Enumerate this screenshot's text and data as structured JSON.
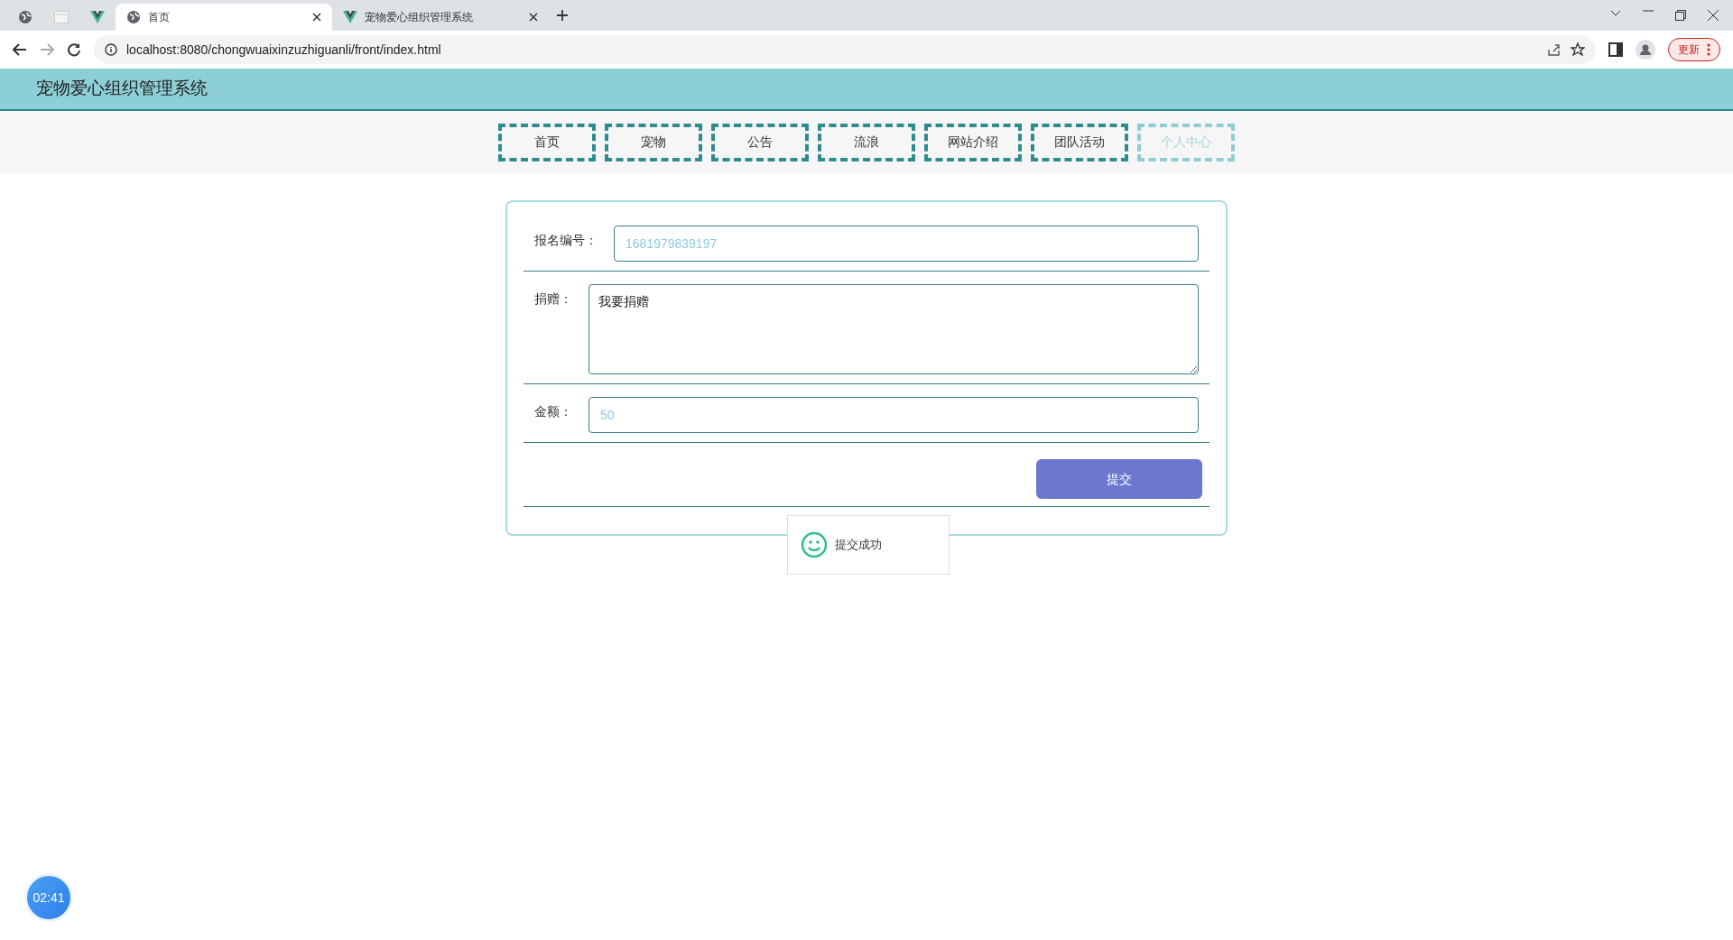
{
  "browser": {
    "tabs": [
      {
        "kind": "pinned",
        "selected": false
      },
      {
        "kind": "pinned",
        "selected": false
      },
      {
        "kind": "pinned",
        "selected": false
      },
      {
        "kind": "normal",
        "title": "首页",
        "selected": true
      },
      {
        "kind": "normal",
        "title": "宠物爱心组织管理系统",
        "selected": false
      }
    ],
    "url": "localhost:8080/chongwuaixinzuzhiguanli/front/index.html",
    "update_button": "更新"
  },
  "header": {
    "title": "宠物爱心组织管理系统"
  },
  "nav": [
    {
      "label": "首页",
      "selected": false
    },
    {
      "label": "宠物",
      "selected": false
    },
    {
      "label": "公告",
      "selected": false
    },
    {
      "label": "流浪",
      "selected": false
    },
    {
      "label": "网站介绍",
      "selected": false
    },
    {
      "label": "团队活动",
      "selected": false
    },
    {
      "label": "个人中心",
      "selected": true
    }
  ],
  "form": {
    "fields": [
      {
        "kind": "input",
        "label": "报名编号：",
        "value": "1681979839197",
        "readonly": true
      },
      {
        "kind": "textarea",
        "label": "捐赠：",
        "value": "我要捐赠",
        "readonly": false
      },
      {
        "kind": "input",
        "label": "金额：",
        "value": "50",
        "readonly": true
      }
    ],
    "submit": "提交"
  },
  "toast": {
    "message": "提交成功"
  },
  "timer": {
    "text": "02:41"
  }
}
